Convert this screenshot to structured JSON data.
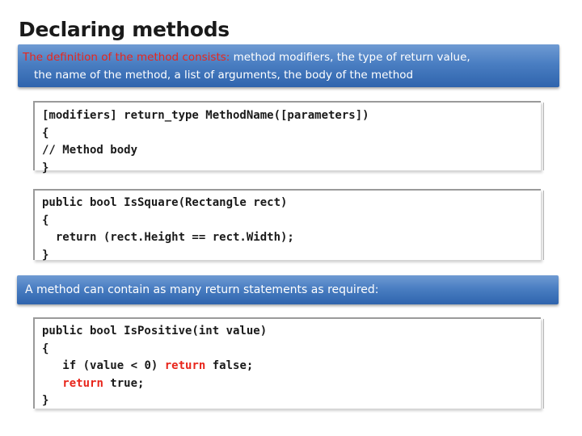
{
  "slide": {
    "title": "Declaring methods",
    "definition": {
      "label": "The definition of the method consists:",
      "text_line1": " method modifiers, the type of return value,",
      "text_line2": "the name of the method, a list of arguments, the body of the method"
    },
    "syntax_code": {
      "line1": "[modifiers] return_type MethodName([parameters])",
      "line2": "{",
      "line3": "// Method body",
      "line4": "}"
    },
    "example1_code": {
      "line1": "public bool IsSquare(Rectangle rect)",
      "line2": "{",
      "line3": "  return (rect.Height == rect.Width);",
      "line4": "}"
    },
    "note": "A method can contain as many return statements as required:",
    "example2_code": {
      "line1": "public bool IsPositive(int value)",
      "line2": "{",
      "line3_indent": "   ",
      "line3_a": "if (value < 0) ",
      "line3_return": "return",
      "line3_b": " false;",
      "line4_indent": "   ",
      "line4_return": "return",
      "line4_b": " true;",
      "line5": "}"
    }
  },
  "colors": {
    "banner": "#4a7ec2",
    "highlight_red": "#e8261c",
    "text": "#1a1a1a"
  }
}
